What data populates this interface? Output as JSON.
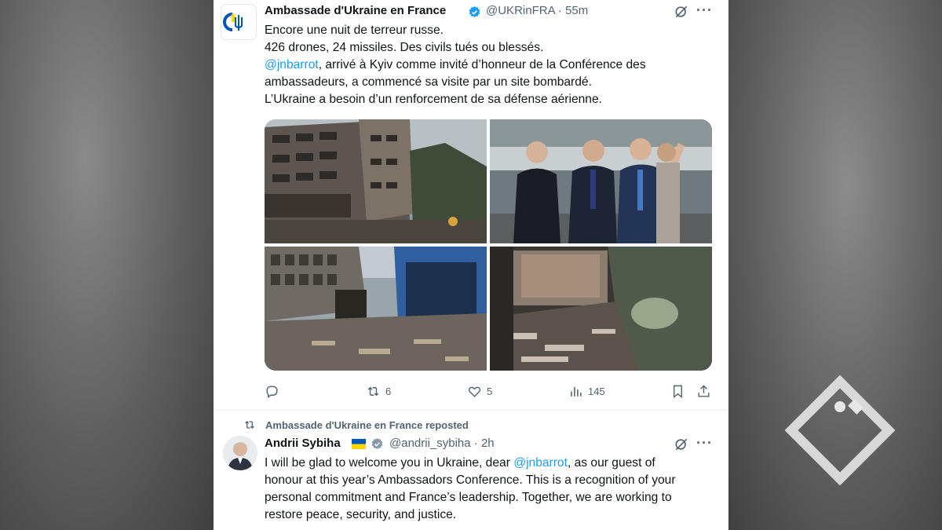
{
  "tweet1": {
    "author": "Ambassade d'Ukraine en France",
    "handle": "@UKRinFRA",
    "time": "55m",
    "lines": [
      "Encore une nuit de terreur russe.",
      "426 drones, 24 missiles. Des civils tués ou blessés."
    ],
    "mention": "@jnbarrot",
    "mention_rest": ", arrivé à Kyiv comme invité d’honneur de la Conférence des",
    "line4": "ambassadeurs, a commencé sa visite par un site bombardé.",
    "line5": "L’Ukraine a besoin d’un renforcement de sa défense aérienne.",
    "reposts": "6",
    "likes": "5",
    "views": "145"
  },
  "repost_label": "Ambassade d'Ukraine en France reposted",
  "tweet2": {
    "author": "Andrii Sybiha",
    "handle": "@andrii_sybiha",
    "time": "2h",
    "line1_a": "I will be glad to welcome you in Ukraine, dear ",
    "line1_mention": "@jnbarrot",
    "line1_b": ", as our guest of",
    "line2": "honour at this year’s Ambassadors Conference. This is a recognition of your",
    "line3": "personal commitment and France’s leadership. Together, we are working to",
    "line4": "restore peace, security, and justice."
  },
  "colors": {
    "accent": "#1d9bf0",
    "text": "#0f1419",
    "muted": "#536471",
    "ukraine_blue": "#0057b7",
    "ukraine_yellow": "#ffd700"
  },
  "icons": {
    "verified": "verified-badge-icon",
    "grok": "grok-icon",
    "more": "more-icon",
    "reply": "reply-icon",
    "repost": "repost-icon",
    "like": "heart-icon",
    "views": "views-icon",
    "bookmark": "bookmark-icon",
    "share": "share-icon"
  }
}
